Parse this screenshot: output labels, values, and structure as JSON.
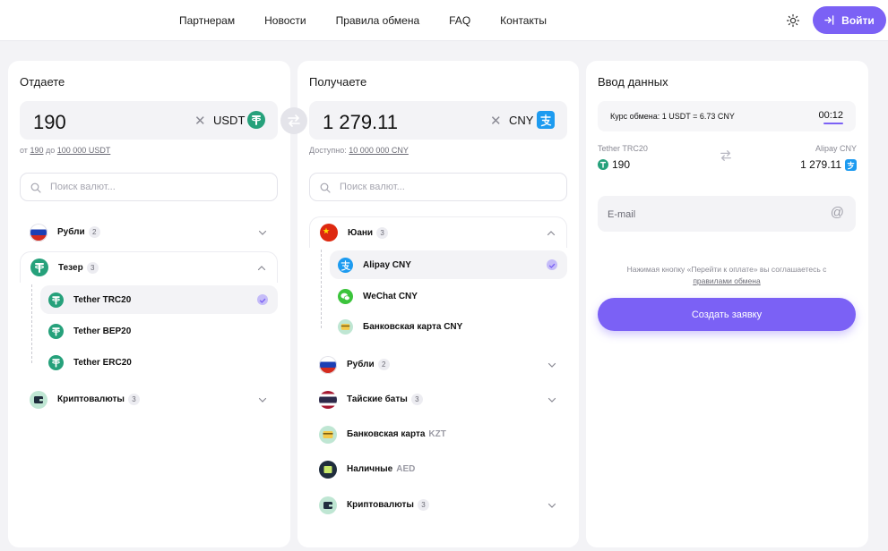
{
  "header": {
    "nav": [
      "Партнерам",
      "Новости",
      "Правила обмена",
      "FAQ",
      "Контакты"
    ],
    "login_label": "Войти"
  },
  "give": {
    "title": "Отдаете",
    "amount": "190",
    "currency": "USDT",
    "limits_prefix": "от",
    "limits_min": "190",
    "limits_mid": "до",
    "limits_max": "100 000 USDT",
    "search_placeholder": "Поиск валют...",
    "groups": [
      {
        "label": "Рубли",
        "count": "2"
      },
      {
        "label": "Тезер",
        "count": "3"
      },
      {
        "label": "Криптовалюты",
        "count": "3"
      }
    ],
    "tether_items": [
      "Tether TRC20",
      "Tether BEP20",
      "Tether ERC20"
    ]
  },
  "receive": {
    "title": "Получаете",
    "amount": "1 279.11",
    "currency": "CNY",
    "available_prefix": "Доступно:",
    "available_value": "10 000 000 CNY",
    "search_placeholder": "Поиск валют...",
    "yuan_group": {
      "label": "Юани",
      "count": "3"
    },
    "yuan_items": [
      "Alipay CNY",
      "WeChat CNY",
      "Банковская карта CNY"
    ],
    "groups": [
      {
        "label": "Рубли",
        "count": "2"
      },
      {
        "label": "Тайские баты",
        "count": "3"
      },
      {
        "label": "Банковская карта",
        "suffix": "KZT"
      },
      {
        "label": "Наличные",
        "suffix": "AED"
      },
      {
        "label": "Криптовалюты",
        "count": "3"
      }
    ]
  },
  "form": {
    "title": "Ввод данных",
    "rate": "Курс обмена: 1 USDT = 6.73 CNY",
    "timer": "00:12",
    "from_label": "Tether TRC20",
    "from_value": "190",
    "to_label": "Alipay CNY",
    "to_value": "1 279.11",
    "email_placeholder": "E-mail",
    "agree_text": "Нажимая кнопку «Перейти к оплате» вы соглашаетесь с",
    "agree_link": "правилами обмена",
    "submit_label": "Создать заявку"
  },
  "colors": {
    "accent": "#7b61f5",
    "tether": "#26a17b",
    "alipay": "#1d9bf0",
    "wechat": "#3cc43c"
  },
  "icons": {
    "theme": "sun-icon",
    "login": "login-arrow-icon",
    "swap": "swap-arrows-icon",
    "search": "search-icon",
    "clear": "close-icon",
    "email": "at-icon"
  }
}
